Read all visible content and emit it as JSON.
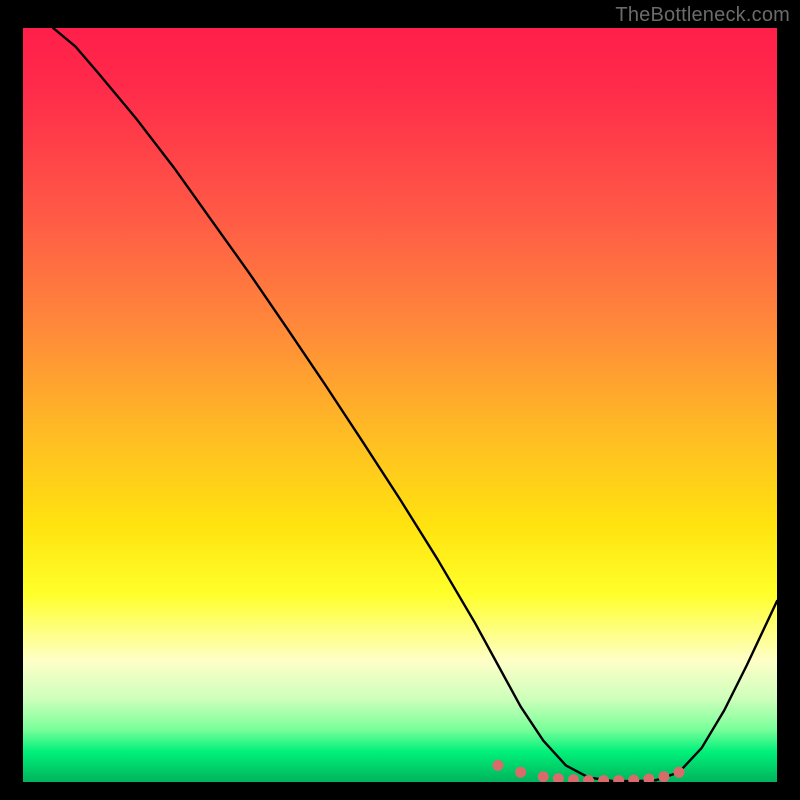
{
  "attribution": "TheBottleneck.com",
  "chart_data": {
    "type": "line",
    "title": "",
    "xlabel": "",
    "ylabel": "",
    "xlim": [
      0,
      100
    ],
    "ylim": [
      0,
      100
    ],
    "series": [
      {
        "name": "curve",
        "x": [
          4,
          7,
          10,
          15,
          20,
          25,
          30,
          35,
          40,
          45,
          50,
          55,
          60,
          63,
          66,
          69,
          72,
          75,
          78,
          81,
          84,
          87,
          90,
          93,
          96,
          100
        ],
        "y": [
          100,
          97.5,
          94,
          88,
          81.5,
          74.5,
          67.5,
          60.2,
          52.8,
          45.2,
          37.5,
          29.5,
          21,
          15.5,
          10,
          5.5,
          2.2,
          0.6,
          0.15,
          0.1,
          0.25,
          1.3,
          4.5,
          9.5,
          15.5,
          24
        ]
      }
    ],
    "optimum_band": {
      "x_start": 63,
      "x_end": 87
    },
    "markers": {
      "x": [
        63,
        66,
        69,
        71,
        73,
        75,
        77,
        79,
        81,
        83,
        85,
        87
      ],
      "y": [
        2.2,
        1.3,
        0.7,
        0.45,
        0.3,
        0.2,
        0.18,
        0.19,
        0.25,
        0.4,
        0.7,
        1.3
      ]
    },
    "background_gradient": {
      "type": "vertical",
      "stops": [
        {
          "pos": 0,
          "color": "#ff1f4a"
        },
        {
          "pos": 25,
          "color": "#ff5a46"
        },
        {
          "pos": 55,
          "color": "#ffc022"
        },
        {
          "pos": 75,
          "color": "#ffff2a"
        },
        {
          "pos": 93,
          "color": "#7aff9a"
        },
        {
          "pos": 100,
          "color": "#00b45d"
        }
      ]
    }
  }
}
